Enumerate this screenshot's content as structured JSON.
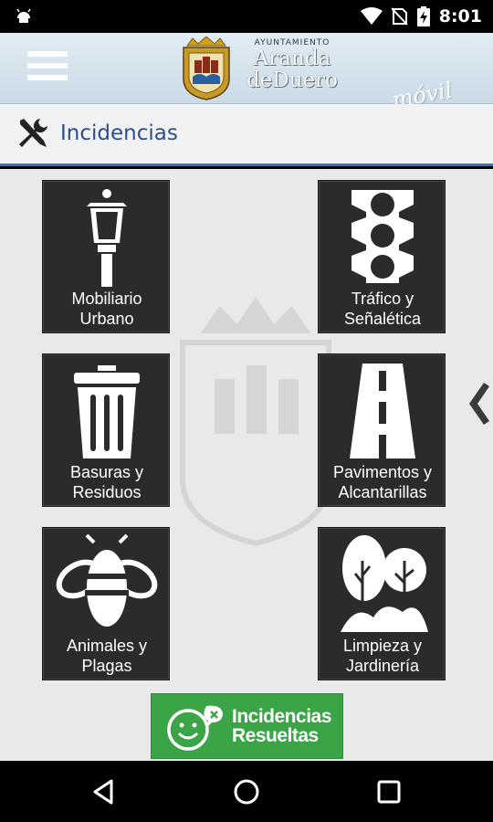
{
  "status_bar": {
    "time": "8:01",
    "icons": [
      "android-icon",
      "wifi-icon",
      "no-sim-icon",
      "battery-charging-icon"
    ]
  },
  "header": {
    "menu_icon": "hamburger-icon",
    "logo_small": "AYUNTAMIENTO",
    "logo_line1": "Aranda",
    "logo_line2": "deDuero",
    "logo_suffix": "móvil"
  },
  "section": {
    "icon": "tools-icon",
    "title": "Incidencias"
  },
  "tiles": [
    {
      "line1": "Mobiliario",
      "line2": "Urbano",
      "icon": "street-lamp-icon"
    },
    {
      "line1": "Tráfico y",
      "line2": "Señalética",
      "icon": "traffic-light-icon"
    },
    {
      "line1": "Basuras y",
      "line2": "Residuos",
      "icon": "trash-can-icon"
    },
    {
      "line1": "Pavimentos y",
      "line2": "Alcantarillas",
      "icon": "road-icon"
    },
    {
      "line1": "Animales y",
      "line2": "Plagas",
      "icon": "bee-icon"
    },
    {
      "line1": "Limpieza y",
      "line2": "Jardinería",
      "icon": "trees-icon"
    }
  ],
  "resolved": {
    "line1": "Incidencias",
    "line2": "Resueltas",
    "icon": "smiley-icon"
  },
  "colors": {
    "accent_blue": "#3b72b9",
    "title_blue": "#2b4f8c",
    "tile_bg": "#2b2b2b",
    "resolved_green": "#3aa446"
  }
}
